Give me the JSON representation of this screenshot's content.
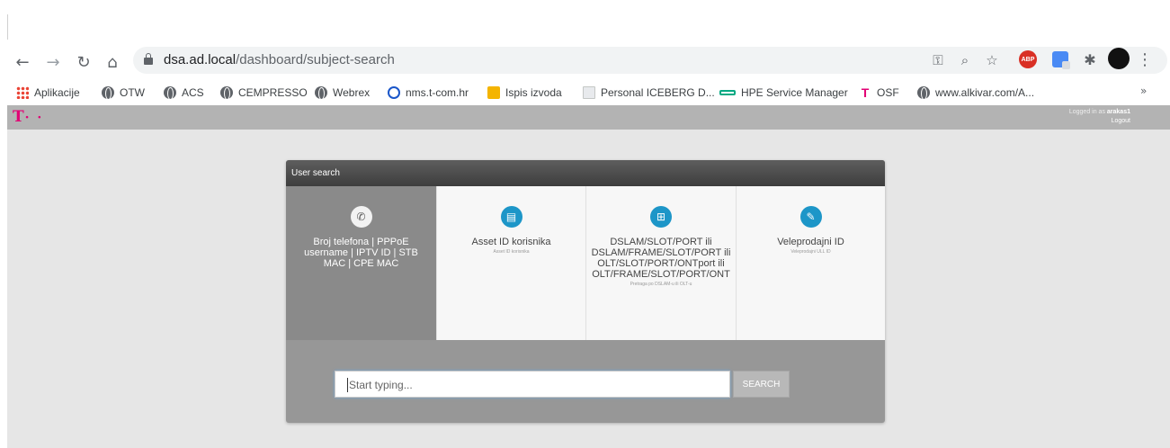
{
  "browser": {
    "nav": {
      "back_icon": "back-arrow-icon",
      "forward_icon": "forward-arrow-icon",
      "reload_icon": "reload-icon",
      "home_icon": "home-icon"
    },
    "url_host": "dsa.ad.local",
    "url_path": "/dashboard/subject-search",
    "omnibox_icons": [
      "key-icon",
      "zoom-icon",
      "star-icon"
    ],
    "extensions": {
      "abp_label": "ABP"
    }
  },
  "bookmarks": [
    {
      "label": "Aplikacije",
      "icon": "apps-grid-icon"
    },
    {
      "label": "OTW",
      "icon": "globe-icon"
    },
    {
      "label": "ACS",
      "icon": "globe-icon"
    },
    {
      "label": "CEMPRESSO",
      "icon": "globe-icon"
    },
    {
      "label": "Webrex",
      "icon": "globe-icon"
    },
    {
      "label": "nms.t-com.hr",
      "icon": "nms-icon"
    },
    {
      "label": "Ispis izvoda",
      "icon": "ispis-icon"
    },
    {
      "label": "Personal ICEBERG D...",
      "icon": "document-icon"
    },
    {
      "label": "HPE Service Manager",
      "icon": "hpe-icon"
    },
    {
      "label": "OSF",
      "icon": "telekom-icon"
    },
    {
      "label": "www.alkivar.com/A...",
      "icon": "globe-icon"
    }
  ],
  "bookmarks_more": "»",
  "app": {
    "logo_mark": "T",
    "logo_dots": "· ·",
    "logged_in_prefix": "Logged in as ",
    "username": "arakas1",
    "logout": "Logout"
  },
  "panel": {
    "title": "User search",
    "options": [
      {
        "title": "Broj telefona | PPPoE username | IPTV ID | STB MAC | CPE MAC",
        "sub": "",
        "icon": "phone-icon"
      },
      {
        "title": "Asset ID korisnika",
        "sub": "Asset ID korisnika",
        "icon": "inbox-icon"
      },
      {
        "title": "DSLAM/SLOT/PORT ili DSLAM/FRAME/SLOT/PORT ili OLT/SLOT/PORT/ONTport ili OLT/FRAME/SLOT/PORT/ONT",
        "sub": "Pretraga po DSLAM-u ili OLT-u",
        "icon": "network-icon"
      },
      {
        "title": "Veleprodajni ID",
        "sub": "Veleprodajni ULL ID",
        "icon": "edit-icon"
      }
    ],
    "search_placeholder": "Start typing...",
    "search_button": "SEARCH"
  }
}
